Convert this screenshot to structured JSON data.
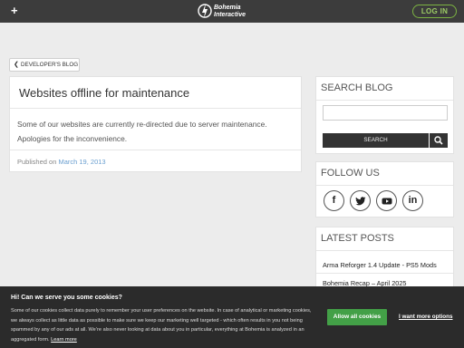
{
  "header": {
    "menu_icon": "plus-icon",
    "brand_line1": "Bohemia",
    "brand_line2": "Interactive",
    "login_label": "LOG IN",
    "accent": "#7cb342"
  },
  "breadcrumb": {
    "back_label": "DEVELOPER'S BLOG",
    "icon": "chevron-left-icon"
  },
  "post": {
    "title": "Websites offline for maintenance",
    "body": "Some of our websites are currently re-directed due to server maintenance. Apologies for the inconvenience.",
    "published_prefix": "Published on",
    "published_date": "March 19, 2013",
    "date_color": "#6a9fd0"
  },
  "sidebar": {
    "search": {
      "title": "SEARCH BLOG",
      "placeholder": "",
      "button_label": "SEARCH",
      "icon": "search-icon"
    },
    "follow": {
      "title": "FOLLOW US",
      "icons": [
        "facebook-icon",
        "twitter-icon",
        "youtube-icon",
        "linkedin-icon"
      ],
      "facebook_glyph": "f",
      "linkedin_glyph": "in"
    },
    "latest": {
      "title": "LATEST POSTS",
      "items": [
        "Arma Reforger 1.4 Update - PS5 Mods",
        "Bohemia Recap – April 2025"
      ]
    }
  },
  "cookie": {
    "title": "Hi! Can we serve you some cookies?",
    "text": "Some of our cookies collect data purely to remember your user preferences on the website. In case of analytical or marketing cookies, we always collect as little data as possible to make sure we keep our marketing well targeted - which often results in you not being spammed by any of our ads at all. We’re also never looking at data about you in particular, everything at Bohemia is analyzed in an aggregated form.",
    "learn_more": "Learn more",
    "allow_label": "Allow all cookies",
    "more_options_label": "I want more options",
    "allow_color": "#43a047"
  }
}
